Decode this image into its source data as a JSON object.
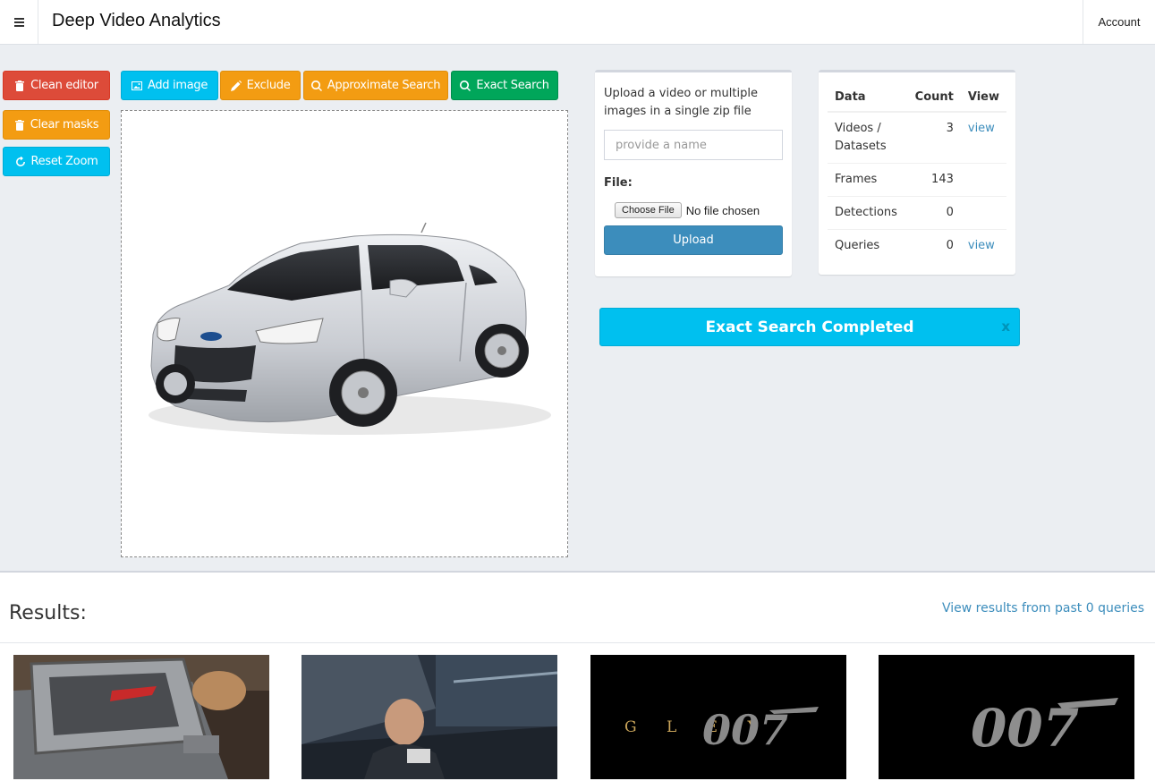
{
  "header": {
    "title": "Deep Video Analytics",
    "account_label": "Account"
  },
  "toolbar": {
    "clean_editor": "Clean editor",
    "clear_masks": "Clear masks",
    "reset_zoom": "Reset Zoom",
    "add_image": "Add image",
    "exclude": "Exclude",
    "approximate_search": "Approximate Search",
    "exact_search": "Exact Search"
  },
  "upload": {
    "instructions": "Upload a video or multiple images in a single zip file",
    "name_placeholder": "provide a name",
    "file_label": "File:",
    "choose_file": "Choose File",
    "no_file": "No file chosen",
    "upload_button": "Upload"
  },
  "stats": {
    "headers": [
      "Data",
      "Count",
      "View"
    ],
    "rows": [
      {
        "data": "Videos / Datasets",
        "count": "3",
        "view": "view"
      },
      {
        "data": "Frames",
        "count": "143",
        "view": ""
      },
      {
        "data": "Detections",
        "count": "0",
        "view": ""
      },
      {
        "data": "Queries",
        "count": "0",
        "view": "view"
      }
    ]
  },
  "alert": {
    "message": "Exact Search Completed",
    "close": "x"
  },
  "results": {
    "title": "Results:",
    "past_link": "View results from past 0 queries",
    "thumb_texts": [
      "G L E Y",
      "007",
      "007"
    ]
  },
  "colors": {
    "red": "#dd4b39",
    "orange": "#f39c12",
    "aqua": "#00c0ef",
    "green": "#00a65a",
    "primary": "#3c8dbc"
  }
}
